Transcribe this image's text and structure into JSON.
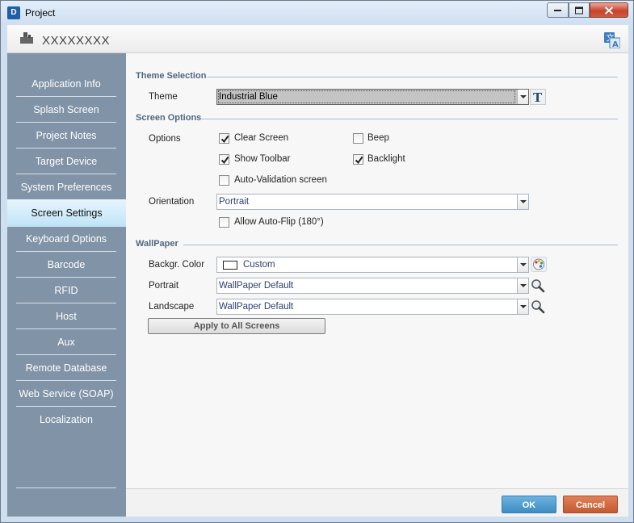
{
  "window": {
    "title": "Project",
    "app_icon_text": "D"
  },
  "header": {
    "project_name": "XXXXXXXX"
  },
  "sidebar": {
    "items": [
      {
        "label": "Application Info"
      },
      {
        "label": "Splash Screen"
      },
      {
        "label": "Project Notes"
      },
      {
        "label": "Target Device"
      },
      {
        "label": "System Preferences"
      },
      {
        "label": "Screen Settings",
        "active": true
      },
      {
        "label": "Keyboard Options"
      },
      {
        "label": "Barcode"
      },
      {
        "label": "RFID"
      },
      {
        "label": "Host"
      },
      {
        "label": "Aux"
      },
      {
        "label": "Remote Database"
      },
      {
        "label": "Web Service (SOAP)"
      },
      {
        "label": "Localization"
      }
    ]
  },
  "theme_section": {
    "title": "Theme Selection",
    "theme_label": "Theme",
    "theme_value": "Industrial Blue"
  },
  "screen_options": {
    "title": "Screen Options",
    "options_label": "Options",
    "clear_screen": {
      "label": "Clear Screen",
      "checked": true
    },
    "beep": {
      "label": "Beep",
      "checked": false
    },
    "show_toolbar": {
      "label": "Show Toolbar",
      "checked": true
    },
    "backlight": {
      "label": "Backlight",
      "checked": true
    },
    "auto_validation": {
      "label": "Auto-Validation screen",
      "checked": false
    },
    "orientation_label": "Orientation",
    "orientation_value": "Portrait",
    "allow_auto_flip": {
      "label": "Allow Auto-Flip (180°)",
      "checked": false
    }
  },
  "wallpaper": {
    "title": "WallPaper",
    "bg_color_label": "Backgr. Color",
    "bg_color_value": "Custom",
    "bg_color_swatch": "#ffffff",
    "portrait_label": "Portrait",
    "portrait_value": "WallPaper Default",
    "landscape_label": "Landscape",
    "landscape_value": "WallPaper Default",
    "apply_label": "Apply to All Screens"
  },
  "footer": {
    "ok_label": "OK",
    "cancel_label": "Cancel"
  },
  "colors": {
    "sidebar_bg": "#8193a7",
    "ok_button": "#3d8dc4",
    "cancel_button": "#c45a30",
    "section_title": "#4e6782"
  }
}
